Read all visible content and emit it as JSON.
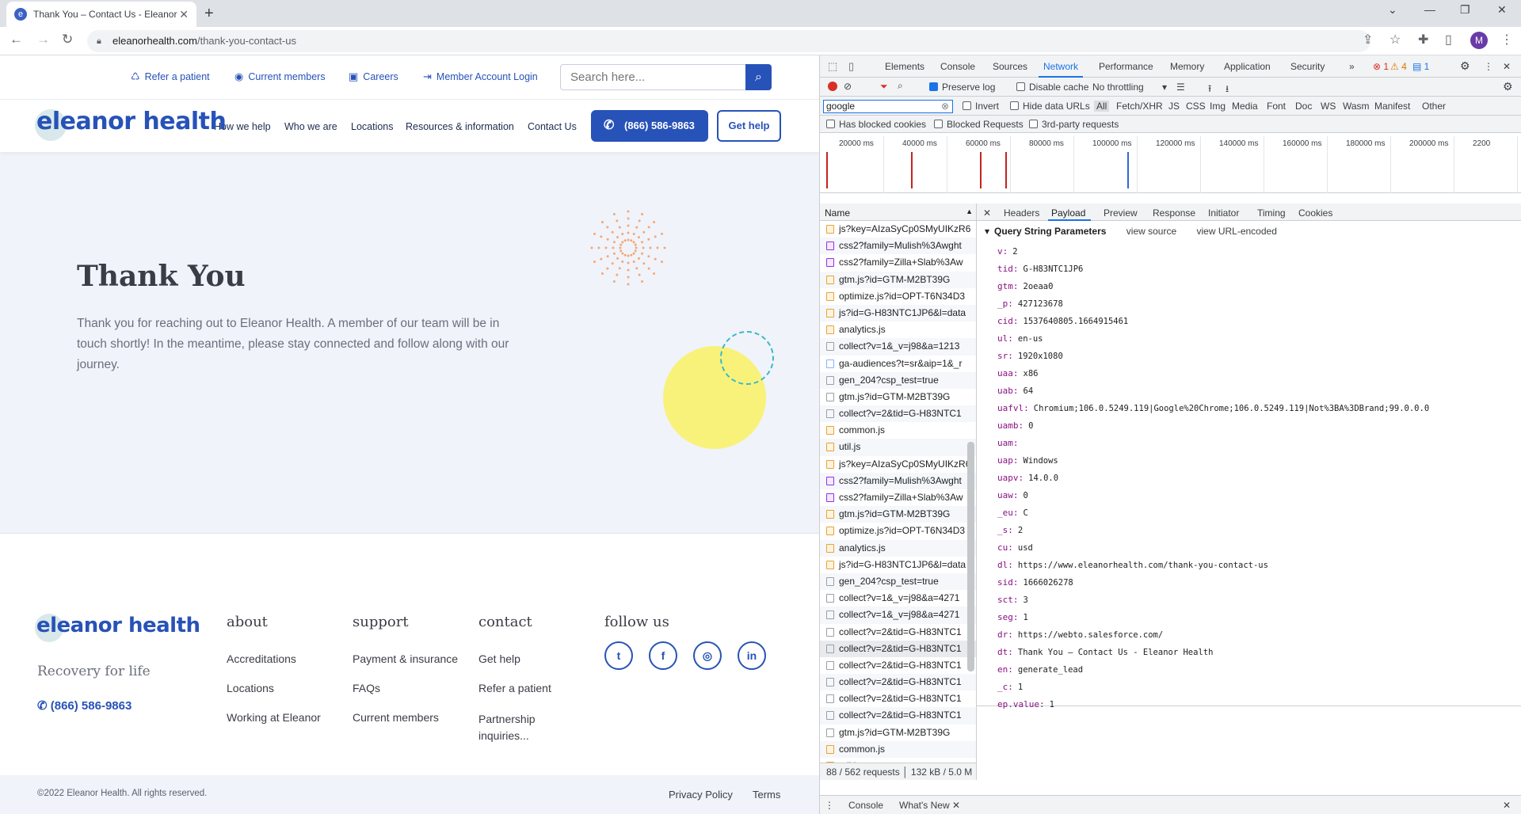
{
  "browser": {
    "tab_title": "Thank You – Contact Us - Eleanor",
    "url_domain": "eleanorhealth.com",
    "url_path": "/thank-you-contact-us",
    "avatar_letter": "M"
  },
  "site": {
    "top_links": [
      "Refer a patient",
      "Current members",
      "Careers",
      "Member Account Login"
    ],
    "search_placeholder": "Search here...",
    "logo_text": "eleanor health",
    "nav": [
      "How we help",
      "Who we are",
      "Locations",
      "Resources & information",
      "Contact Us"
    ],
    "phone": "(866) 586-9863",
    "get_help": "Get help",
    "hero_title": "Thank You",
    "hero_text": "Thank you for reaching out to Eleanor Health. A member of our team will be in touch shortly! In the meantime, please stay connected and follow along with our journey.",
    "footer": {
      "tagline": "Recovery for life",
      "phone": "(866) 586-9863",
      "about_head": "about",
      "about": [
        "Accreditations",
        "Locations",
        "Working at Eleanor"
      ],
      "support_head": "support",
      "support": [
        "Payment & insurance",
        "FAQs",
        "Current members"
      ],
      "contact_head": "contact",
      "contact": [
        "Get help",
        "Refer a patient",
        "Partnership inquiries..."
      ],
      "follow_head": "follow us",
      "copyright": "©2022 Eleanor Health. All rights reserved.",
      "privacy": "Privacy Policy",
      "terms": "Terms"
    },
    "colors": {
      "brand": "#2752b8",
      "sun": "#f9f27a",
      "burst": "#f4a877",
      "ring": "#3cb8c8"
    }
  },
  "devtools": {
    "tabs": [
      "Elements",
      "Console",
      "Sources",
      "Network",
      "Performance",
      "Memory",
      "Application",
      "Security"
    ],
    "active_tab": "Network",
    "badges": {
      "errors": "1",
      "warnings": "4",
      "messages": "1"
    },
    "preserve_log": "Preserve log",
    "disable_cache": "Disable cache",
    "throttling": "No throttling",
    "filter_value": "google",
    "invert": "Invert",
    "hide_data_urls": "Hide data URLs",
    "type_filters": [
      "All",
      "Fetch/XHR",
      "JS",
      "CSS",
      "Img",
      "Media",
      "Font",
      "Doc",
      "WS",
      "Wasm",
      "Manifest",
      "Other"
    ],
    "cookie_filters": [
      "Has blocked cookies",
      "Blocked Requests",
      "3rd-party requests"
    ],
    "timeline_ticks": [
      "20000 ms",
      "40000 ms",
      "60000 ms",
      "80000 ms",
      "100000 ms",
      "120000 ms",
      "140000 ms",
      "160000 ms",
      "180000 ms",
      "200000 ms",
      "2200"
    ],
    "name_header": "Name",
    "requests": [
      {
        "name": "js?key=AIzaSyCp0SMyUIKzR6",
        "type": "js"
      },
      {
        "name": "css2?family=Mulish%3Awght",
        "type": "css"
      },
      {
        "name": "css2?family=Zilla+Slab%3Aw",
        "type": "css"
      },
      {
        "name": "gtm.js?id=GTM-M2BT39G",
        "type": "js"
      },
      {
        "name": "optimize.js?id=OPT-T6N34D3",
        "type": "js"
      },
      {
        "name": "js?id=G-H83NTC1JP6&l=data",
        "type": "js"
      },
      {
        "name": "analytics.js",
        "type": "js"
      },
      {
        "name": "collect?v=1&_v=j98&a=1213",
        "type": "doc"
      },
      {
        "name": "ga-audiences?t=sr&aip=1&_r",
        "type": "img"
      },
      {
        "name": "gen_204?csp_test=true",
        "type": "doc"
      },
      {
        "name": "gtm.js?id=GTM-M2BT39G",
        "type": "doc"
      },
      {
        "name": "collect?v=2&tid=G-H83NTC1",
        "type": "doc"
      },
      {
        "name": "common.js",
        "type": "js"
      },
      {
        "name": "util.js",
        "type": "js"
      },
      {
        "name": "js?key=AIzaSyCp0SMyUIKzR6",
        "type": "js"
      },
      {
        "name": "css2?family=Mulish%3Awght",
        "type": "css"
      },
      {
        "name": "css2?family=Zilla+Slab%3Aw",
        "type": "css"
      },
      {
        "name": "gtm.js?id=GTM-M2BT39G",
        "type": "js"
      },
      {
        "name": "optimize.js?id=OPT-T6N34D3",
        "type": "js"
      },
      {
        "name": "analytics.js",
        "type": "js"
      },
      {
        "name": "js?id=G-H83NTC1JP6&l=data",
        "type": "js"
      },
      {
        "name": "gen_204?csp_test=true",
        "type": "doc"
      },
      {
        "name": "collect?v=1&_v=j98&a=4271",
        "type": "doc"
      },
      {
        "name": "collect?v=1&_v=j98&a=4271",
        "type": "doc"
      },
      {
        "name": "collect?v=2&tid=G-H83NTC1",
        "type": "doc"
      },
      {
        "name": "collect?v=2&tid=G-H83NTC1",
        "type": "doc"
      },
      {
        "name": "collect?v=2&tid=G-H83NTC1",
        "type": "doc"
      },
      {
        "name": "collect?v=2&tid=G-H83NTC1",
        "type": "doc"
      },
      {
        "name": "collect?v=2&tid=G-H83NTC1",
        "type": "doc"
      },
      {
        "name": "collect?v=2&tid=G-H83NTC1",
        "type": "doc"
      },
      {
        "name": "gtm.js?id=GTM-M2BT39G",
        "type": "doc"
      },
      {
        "name": "common.js",
        "type": "js"
      },
      {
        "name": "util.js",
        "type": "js"
      }
    ],
    "selected_index": 25,
    "status": "88 / 562 requests",
    "transferred": "132 kB / 5.0 M",
    "panel_tabs": [
      "Headers",
      "Payload",
      "Preview",
      "Response",
      "Initiator",
      "Timing",
      "Cookies"
    ],
    "active_panel": "Payload",
    "qsp_title": "Query String Parameters",
    "view_source": "view source",
    "view_url_encoded": "view URL-encoded",
    "params": [
      {
        "k": "v:",
        "v": "2"
      },
      {
        "k": "tid:",
        "v": "G-H83NTC1JP6"
      },
      {
        "k": "gtm:",
        "v": "2oeaa0"
      },
      {
        "k": "_p:",
        "v": "427123678"
      },
      {
        "k": "cid:",
        "v": "1537640805.1664915461"
      },
      {
        "k": "ul:",
        "v": "en-us"
      },
      {
        "k": "sr:",
        "v": "1920x1080"
      },
      {
        "k": "uaa:",
        "v": "x86"
      },
      {
        "k": "uab:",
        "v": "64"
      },
      {
        "k": "uafvl:",
        "v": "Chromium;106.0.5249.119|Google%20Chrome;106.0.5249.119|Not%3BA%3DBrand;99.0.0.0"
      },
      {
        "k": "uamb:",
        "v": "0"
      },
      {
        "k": "uam:",
        "v": ""
      },
      {
        "k": "uap:",
        "v": "Windows"
      },
      {
        "k": "uapv:",
        "v": "14.0.0"
      },
      {
        "k": "uaw:",
        "v": "0"
      },
      {
        "k": "_eu:",
        "v": "C"
      },
      {
        "k": "_s:",
        "v": "2"
      },
      {
        "k": "cu:",
        "v": "usd"
      },
      {
        "k": "dl:",
        "v": "https://www.eleanorhealth.com/thank-you-contact-us"
      },
      {
        "k": "sid:",
        "v": "1666026278"
      },
      {
        "k": "sct:",
        "v": "3"
      },
      {
        "k": "seg:",
        "v": "1"
      },
      {
        "k": "dr:",
        "v": "https://webto.salesforce.com/"
      },
      {
        "k": "dt:",
        "v": "Thank You – Contact Us - Eleanor Health"
      },
      {
        "k": "en:",
        "v": "generate_lead"
      },
      {
        "k": "_c:",
        "v": "1"
      },
      {
        "k": "ep.value:",
        "v": "1"
      }
    ],
    "drawer_tabs": [
      "Console",
      "What's New"
    ]
  }
}
